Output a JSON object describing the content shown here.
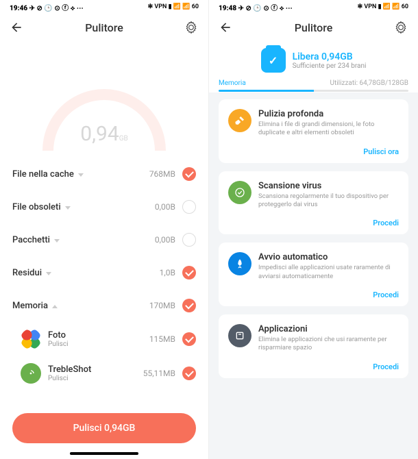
{
  "a": {
    "statusbar": {
      "time": "19:46",
      "icons_left": "✈ ⊘ 🕒 ⊙ ⓕ ⟡ ⋯",
      "icons_right": "✻ VPN ▮ 📶 📶 60"
    },
    "header": {
      "title": "Pulitore"
    },
    "gauge": {
      "value": "0,94",
      "unit": "GB"
    },
    "rows": [
      {
        "label": "File nella cache",
        "caret": "down",
        "size": "768MB",
        "checked": true
      },
      {
        "label": "File obsoleti",
        "caret": "down",
        "size": "0,00B",
        "checked": false
      },
      {
        "label": "Pacchetti",
        "caret": "down",
        "size": "0,00B",
        "checked": false
      },
      {
        "label": "Residui",
        "caret": "down",
        "size": "1,0B",
        "checked": true
      },
      {
        "label": "Memoria",
        "caret": "up",
        "size": "170MB",
        "checked": true
      }
    ],
    "apps": [
      {
        "name": "Foto",
        "action": "Pulisci",
        "size": "115MB",
        "checked": true,
        "icon": "foto"
      },
      {
        "name": "TrebleShot",
        "action": "Pulisci",
        "size": "55,11MB",
        "checked": true,
        "icon": "treble"
      }
    ],
    "cta": "Pulisci 0,94GB"
  },
  "b": {
    "statusbar": {
      "time": "19:48",
      "icons_left": "✈ ⊘ 🕒 ⊙ ⓕ ⟡ ⋯",
      "icons_right": "✻ VPN ▮ 📶 📶 60"
    },
    "header": {
      "title": "Pulitore"
    },
    "hero": {
      "line1": "Libera 0,94GB",
      "line2": "Sufficiente per 234 brani"
    },
    "memory": {
      "label": "Memoria",
      "used": "Utilizzati: 64,78GB/128GB"
    },
    "cards": [
      {
        "title": "Pulizia profonda",
        "desc": "Elimina i file di grandi dimensioni, le foto duplicate e altri elementi obsoleti",
        "btn": "Pulisci ora",
        "color": "orange"
      },
      {
        "title": "Scansione virus",
        "desc": "Scansiona regolarmente il tuo dispositivo per proteggerlo dai virus",
        "btn": "Procedi",
        "color": "green"
      },
      {
        "title": "Avvio automatico",
        "desc": "Impedisci alle applicazioni usate raramente di avviarsi automaticamente",
        "btn": "Procedi",
        "color": "blue"
      },
      {
        "title": "Applicazioni",
        "desc": "Elimina le applicazioni che usi raramente per risparmiare spazio",
        "btn": "Procedi",
        "color": "dark"
      }
    ]
  }
}
